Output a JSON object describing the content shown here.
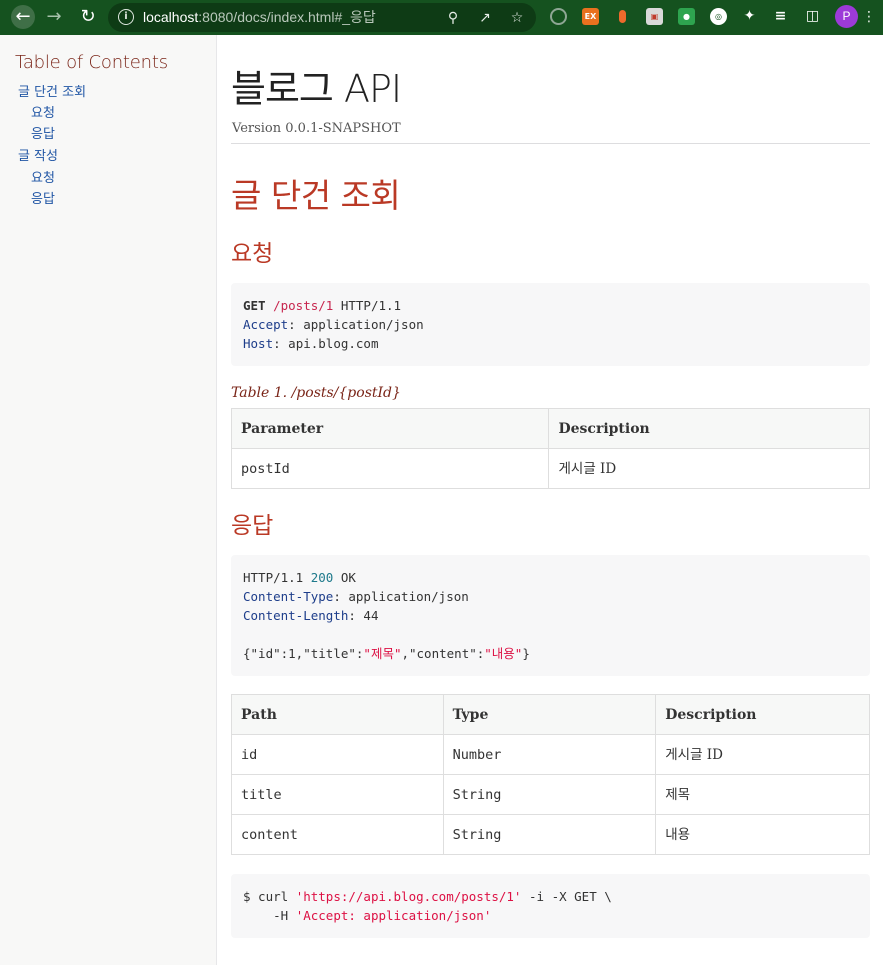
{
  "browser": {
    "url_host": "localhost",
    "url_rest": ":8080/docs/index.html#_응답",
    "profile_initial": "P",
    "ext_badge": "EX",
    "colors": {
      "toolbar": "#15521f",
      "profile": "#9c3ad8"
    }
  },
  "toc": {
    "title": "Table of Contents",
    "items": [
      {
        "label": "글 단건 조회",
        "level": 1
      },
      {
        "label": "요청",
        "level": 2
      },
      {
        "label": "응답",
        "level": 2
      },
      {
        "label": "글 작성",
        "level": 1
      },
      {
        "label": "요청",
        "level": 2
      },
      {
        "label": "응답",
        "level": 2
      }
    ]
  },
  "doc": {
    "title": "블로그 API",
    "version": "Version 0.0.1-SNAPSHOT",
    "section_title": "글 단건 조회",
    "request_heading": "요청",
    "response_heading": "응답",
    "request": {
      "method": "GET",
      "path": "/posts/1",
      "protocol": "HTTP/1.1",
      "headers": [
        {
          "name": "Accept",
          "value": "application/json"
        },
        {
          "name": "Host",
          "value": "api.blog.com"
        }
      ]
    },
    "path_table": {
      "caption": "Table 1. /posts/{postId}",
      "headers": [
        "Parameter",
        "Description"
      ],
      "rows": [
        [
          "postId",
          "게시글 ID"
        ]
      ]
    },
    "response": {
      "protocol": "HTTP/1.1",
      "status_code": "200",
      "status_text": "OK",
      "headers": [
        {
          "name": "Content-Type",
          "value": "application/json"
        },
        {
          "name": "Content-Length",
          "value": "44"
        }
      ],
      "body": {
        "p1": "{\"id\":1,\"title\":",
        "v1": "\"제목\"",
        "p2": ",\"content\":",
        "v2": "\"내용\"",
        "p3": "}"
      }
    },
    "fields_table": {
      "headers": [
        "Path",
        "Type",
        "Description"
      ],
      "rows": [
        [
          "id",
          "Number",
          "게시글 ID"
        ],
        [
          "title",
          "String",
          "제목"
        ],
        [
          "content",
          "String",
          "내용"
        ]
      ]
    },
    "curl": {
      "prompt": "$ curl ",
      "url": "'https://api.blog.com/posts/1'",
      "opts": " -i -X GET \\",
      "indent": "    -H ",
      "header": "'Accept: application/json'"
    }
  }
}
